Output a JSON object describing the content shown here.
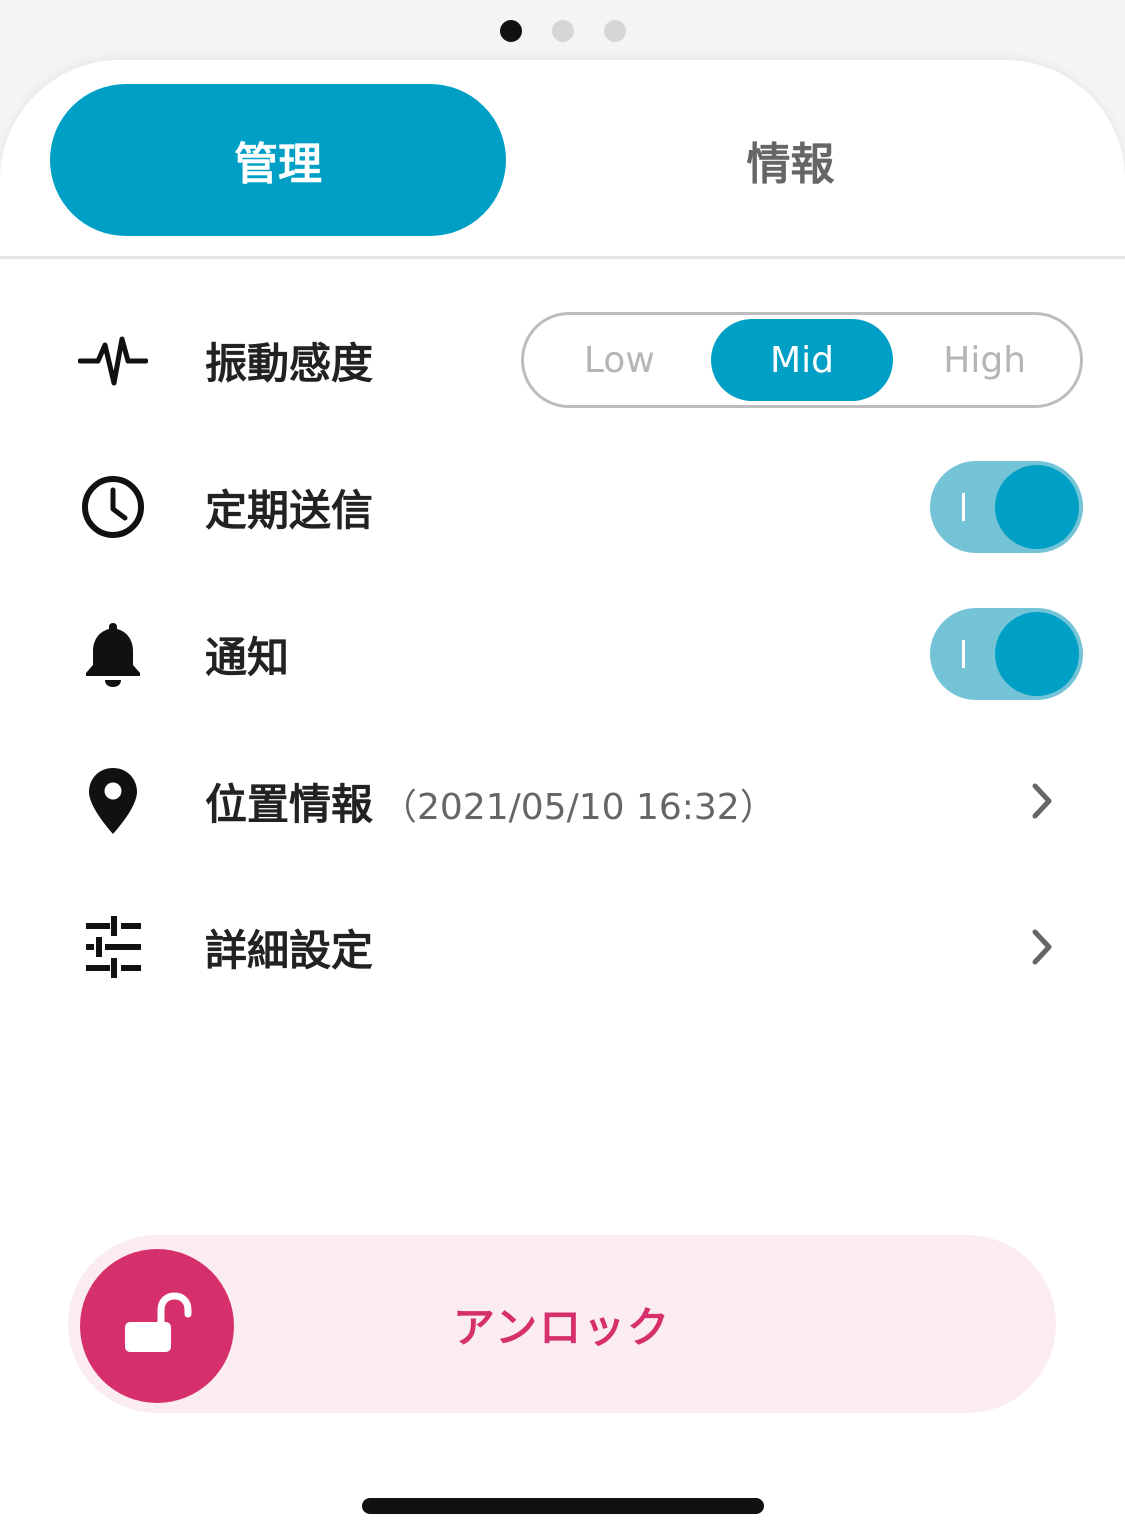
{
  "pager": {
    "count": 3,
    "active_index": 0
  },
  "tabs": [
    {
      "label": "管理",
      "active": true
    },
    {
      "label": "情報",
      "active": false
    }
  ],
  "settings": {
    "vibration": {
      "icon": "pulse-icon",
      "label": "振動感度",
      "options": [
        "Low",
        "Mid",
        "High"
      ],
      "selected": "Mid"
    },
    "periodic_send": {
      "icon": "clock-icon",
      "label": "定期送信",
      "enabled": true
    },
    "notification": {
      "icon": "bell-icon",
      "label": "通知",
      "enabled": true
    },
    "location": {
      "icon": "location-pin-icon",
      "label": "位置情報",
      "timestamp": "（2021/05/10 16:32）"
    },
    "advanced": {
      "icon": "sliders-icon",
      "label": "詳細設定"
    }
  },
  "unlock": {
    "label": "アンロック",
    "icon": "unlock-icon"
  },
  "colors": {
    "accent": "#00a0c6",
    "toggle_track": "#74c3d6",
    "unlock_accent": "#d6306c",
    "unlock_track": "#fbecf0"
  }
}
